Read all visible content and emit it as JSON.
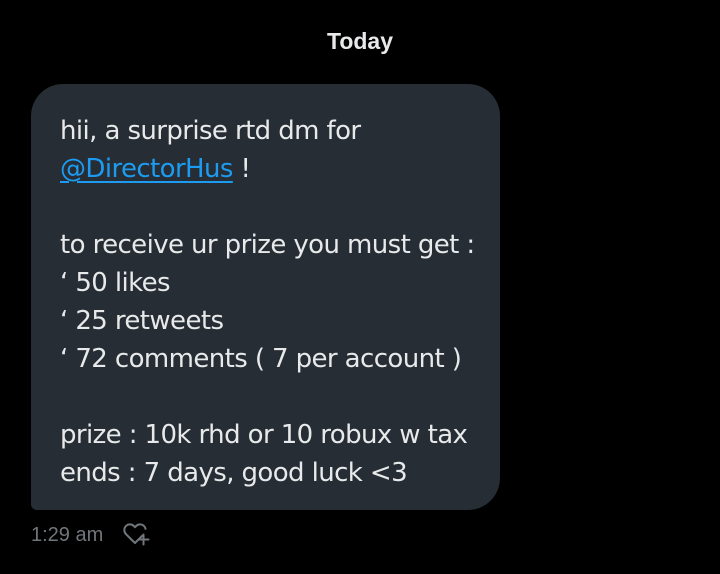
{
  "date_separator": "Today",
  "message": {
    "line1": "hii, a surprise rtd dm for",
    "mention": "@DirectorHus",
    "mention_suffix": " !",
    "line3": "to receive ur prize you must get :",
    "line4": "‘ 50 likes",
    "line5": "‘ 25 retweets",
    "line6": "‘ 72 comments ( 7 per account )",
    "line8": "prize : 10k rhd or 10 robux w tax",
    "line9": "ends : 7 days, good luck <3",
    "timestamp": "1:29 am"
  },
  "icons": {
    "react": "heart-plus-icon"
  },
  "colors": {
    "background": "#000000",
    "bubble": "#262d34",
    "text": "#e7e9ea",
    "mention": "#1d9bf0",
    "muted": "#71767b"
  }
}
